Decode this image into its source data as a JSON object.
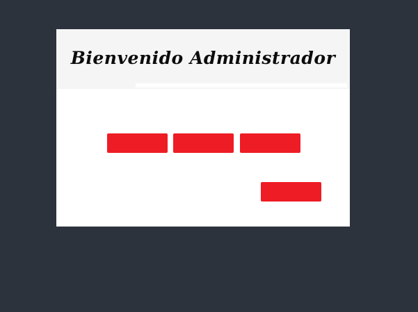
{
  "header": {
    "title": "Bienvenido Administrador"
  },
  "actions": {
    "buttons": [
      {
        "label": ""
      },
      {
        "label": ""
      },
      {
        "label": ""
      }
    ]
  },
  "footer": {
    "button_label": ""
  },
  "colors": {
    "background": "#2d333d",
    "panel": "#ffffff",
    "header": "#f5f5f5",
    "accent": "#ee1c25"
  }
}
